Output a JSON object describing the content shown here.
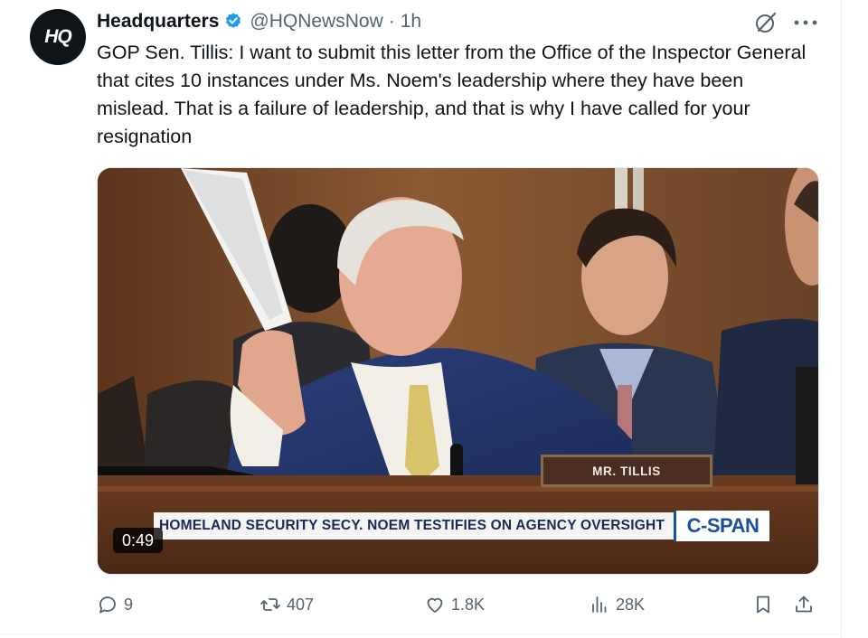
{
  "tweet": {
    "author": {
      "avatar_text": "HQ",
      "display_name": "Headquarters",
      "verified": true,
      "handle": "@HQNewsNow",
      "separator": "·",
      "time": "1h"
    },
    "text": "GOP Sen. Tillis: I want to submit this letter from the Office of the Inspector General that cites 10 instances under Ms. Noem's leadership where they have been mislead. That is a failure of leadership, and that is why I have called for your resignation",
    "media": {
      "type": "video",
      "duration": "0:49",
      "nameplate": "MR. TILLIS",
      "chyron": "HOMELAND SECURITY SECY. NOEM TESTIFIES ON AGENCY OVERSIGHT",
      "network_logo": "C-SPAN"
    },
    "actions": {
      "replies": "9",
      "reposts": "407",
      "likes": "1.8K",
      "views": "28K"
    }
  },
  "icons": {
    "verified": "verified-badge-icon",
    "grok": "grok-icon",
    "more": "more-icon",
    "reply": "reply-icon",
    "repost": "repost-icon",
    "like": "heart-icon",
    "views": "views-chart-icon",
    "bookmark": "bookmark-icon",
    "share": "share-icon"
  },
  "colors": {
    "text_primary": "#0f1419",
    "text_secondary": "#536471",
    "verified_blue": "#1d9bf0",
    "cspan_blue": "#1b4fa0"
  }
}
